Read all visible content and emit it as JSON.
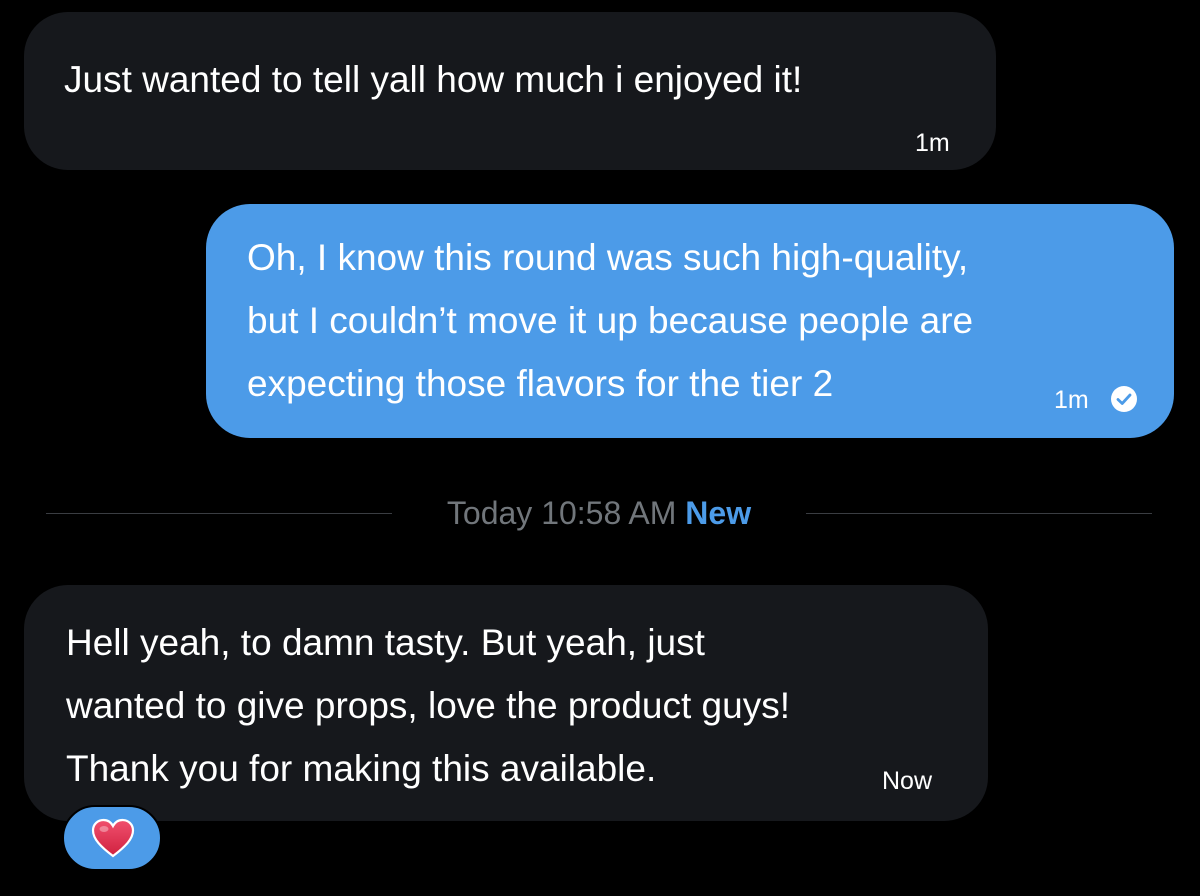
{
  "messages": [
    {
      "direction": "incoming",
      "lines": [
        "Just wanted to tell yall how much i enjoyed it!"
      ],
      "time": "1m"
    },
    {
      "direction": "outgoing",
      "lines": [
        "Oh, I know this round was such high-quality,",
        "but I couldn’t move it up because people are",
        "expecting those flavors for the tier 2"
      ],
      "time": "1m",
      "status_icon": "check-circle-icon"
    },
    {
      "direction": "incoming",
      "lines": [
        "Hell yeah, to damn tasty. But yeah, just",
        "wanted to give props, love the product guys!",
        "Thank you for making this available."
      ],
      "time": "Now",
      "reaction_icon": "heart-icon"
    }
  ],
  "divider": {
    "date_label": "Today 10:58 AM",
    "new_label": "New"
  },
  "colors": {
    "background": "#000000",
    "incoming_bubble": "#16181c",
    "outgoing_bubble": "#4c9be8",
    "accent": "#4c9be8",
    "muted_text": "#71767b",
    "heart": "#e0245e"
  }
}
